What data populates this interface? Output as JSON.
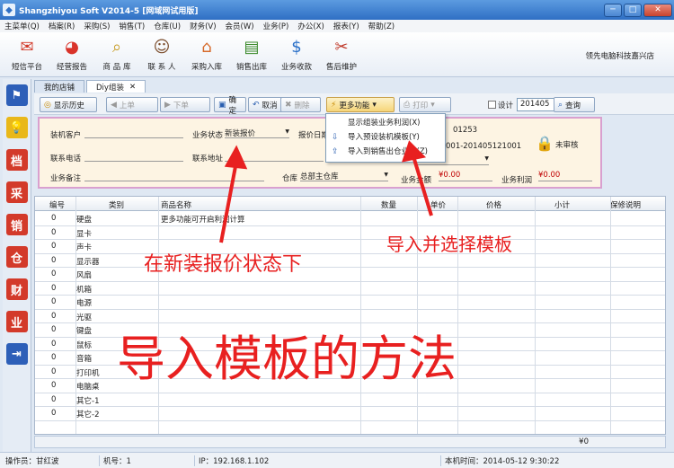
{
  "window": {
    "title": "Shangzhiyou Soft V2014-5 [网域网试用版]"
  },
  "menu": [
    "主菜单(Q)",
    "档案(R)",
    "采购(S)",
    "销售(T)",
    "仓库(U)",
    "财务(V)",
    "会员(W)",
    "业务(P)",
    "办公(X)",
    "报表(Y)",
    "帮助(Z)"
  ],
  "toolbar": [
    {
      "label": "短信平台",
      "icon": "envelope-icon",
      "color": "#d23a2a"
    },
    {
      "label": "经营报告",
      "icon": "pie-chart-icon",
      "color": "#d9332a"
    },
    {
      "label": "商 品 库",
      "icon": "magnifier-icon",
      "color": "#c69a20"
    },
    {
      "label": "联 系 人",
      "icon": "person-icon",
      "color": "#7a4b2a"
    },
    {
      "label": "采购入库",
      "icon": "house-icon",
      "color": "#d66a2a"
    },
    {
      "label": "销售出库",
      "icon": "box-icon",
      "color": "#3a8a2a"
    },
    {
      "label": "业务收款",
      "icon": "dollar-icon",
      "color": "#2a70c8"
    },
    {
      "label": "售后维护",
      "icon": "tools-icon",
      "color": "#c03a2a"
    }
  ],
  "company": "领先电脑科技嘉兴店",
  "sidebar": [
    {
      "icon": "flag-icon",
      "text": "⚑",
      "color": "#2d5fb8"
    },
    {
      "icon": "lightbulb-icon",
      "text": "💡",
      "color": "#e9b81a"
    },
    {
      "icon": "archive-icon",
      "text": "档",
      "color": "#d33a2a"
    },
    {
      "icon": "purchase-icon",
      "text": "采",
      "color": "#d33a2a"
    },
    {
      "icon": "sales-icon",
      "text": "销",
      "color": "#d33a2a"
    },
    {
      "icon": "warehouse-icon",
      "text": "仓",
      "color": "#d33a2a"
    },
    {
      "icon": "finance-icon",
      "text": "财",
      "color": "#d33a2a"
    },
    {
      "icon": "business-icon",
      "text": "业",
      "color": "#d33a2a"
    },
    {
      "icon": "exit-icon",
      "text": "⇥",
      "color": "#2d5fb8"
    }
  ],
  "tabs": [
    "我的店铺",
    "Diy组装"
  ],
  "buttons": {
    "history": "显示历史",
    "prev": "上单",
    "next": "下单",
    "confirm": "确定",
    "cancel": "取消",
    "delete": "删除",
    "more": "更多功能",
    "print": "打印",
    "design": "设计",
    "query": "查询"
  },
  "period_value": "201405",
  "form": {
    "customer_label": "装机客户",
    "status_label": "业务状态",
    "status_value": "新装报价",
    "date_label": "报价日期",
    "order_no_partial": "01253",
    "order_no_full": "001-201405121001",
    "phone_label": "联系电话",
    "address_label": "联系地址",
    "remark_label": "业务备注",
    "warehouse_label": "仓库",
    "warehouse_value": "总部主仓库",
    "amount_label": "业务金额",
    "amount_value": "¥0.00",
    "profit_label": "业务利润",
    "profit_value": "¥0.00",
    "unreviewed": "未审核"
  },
  "dropdown": [
    {
      "label": "显示组装业务利润(X)",
      "icon": ""
    },
    {
      "label": "导入预设装机模板(Y)",
      "icon": "import-icon"
    },
    {
      "label": "导入到销售出仓业务(Z)",
      "icon": "export-icon"
    }
  ],
  "grid": {
    "headers": [
      "编号",
      "类别",
      "商品名称",
      "数量",
      "单价",
      "价格",
      "小计",
      "保修说明"
    ],
    "rows": [
      {
        "id": "0",
        "category": "硬盘",
        "name": "更多功能可开启利润计算"
      },
      {
        "id": "0",
        "category": "显卡",
        "name": ""
      },
      {
        "id": "0",
        "category": "声卡",
        "name": ""
      },
      {
        "id": "0",
        "category": "显示器",
        "name": ""
      },
      {
        "id": "0",
        "category": "风扇",
        "name": ""
      },
      {
        "id": "0",
        "category": "机箱",
        "name": ""
      },
      {
        "id": "0",
        "category": "电源",
        "name": ""
      },
      {
        "id": "0",
        "category": "光驱",
        "name": ""
      },
      {
        "id": "0",
        "category": "键盘",
        "name": ""
      },
      {
        "id": "0",
        "category": "鼠标",
        "name": ""
      },
      {
        "id": "0",
        "category": "音箱",
        "name": ""
      },
      {
        "id": "0",
        "category": "打印机",
        "name": ""
      },
      {
        "id": "0",
        "category": "电脑桌",
        "name": ""
      },
      {
        "id": "0",
        "category": "其它-1",
        "name": ""
      },
      {
        "id": "0",
        "category": "其它-2",
        "name": ""
      }
    ],
    "total": "¥0"
  },
  "status": {
    "operator": "操作员：甘红波",
    "machine": "机号：1",
    "ip": "IP：192.168.1.102",
    "time": "本机时间：2014-05-12 9:30:22"
  },
  "annotations": {
    "status": "在新装报价状态下",
    "template": "导入并选择模板",
    "title": "导入模板的方法",
    "color": "#e82020"
  }
}
